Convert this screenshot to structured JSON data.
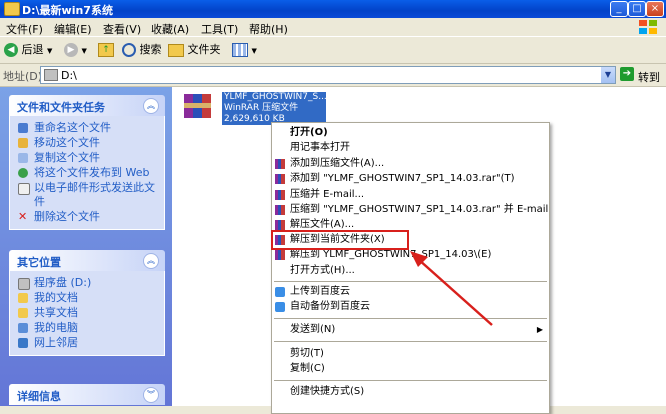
{
  "window": {
    "title": "D:\\最新win7系统"
  },
  "menubar": [
    "文件(F)",
    "编辑(E)",
    "查看(V)",
    "收藏(A)",
    "工具(T)",
    "帮助(H)"
  ],
  "toolbar": {
    "back": "后退",
    "search": "搜索",
    "folders": "文件夹"
  },
  "address": {
    "label": "地址(D)",
    "value": "D:\\",
    "go": "转到"
  },
  "tasks_panel": {
    "title": "文件和文件夹任务",
    "items": [
      "重命名这个文件",
      "移动这个文件",
      "复制这个文件",
      "将这个文件发布到 Web",
      "以电子邮件形式发送此文件",
      "删除这个文件"
    ]
  },
  "places_panel": {
    "title": "其它位置",
    "items": [
      "程序盘 (D:)",
      "我的文档",
      "共享文档",
      "我的电脑",
      "网上邻居"
    ]
  },
  "details_panel": {
    "title": "详细信息"
  },
  "file": {
    "name": "YLMF_GHOSTWIN7_S...",
    "type": "WinRAR 压缩文件",
    "size": "2,629,610 KB"
  },
  "context_menu": {
    "items": [
      "打开(O)",
      "用记事本打开",
      "添加到压缩文件(A)...",
      "添加到 \"YLMF_GHOSTWIN7_SP1_14.03.rar\"(T)",
      "压缩并 E-mail...",
      "压缩到 \"YLMF_GHOSTWIN7_SP1_14.03.rar\" 并 E-mail",
      "解压文件(A)...",
      "解压到当前文件夹(X)",
      "解压到 YLMF_GHOSTWIN7_SP1_14.03\\(E)",
      "打开方式(H)...",
      "上传到百度云",
      "自动备份到百度云",
      "发送到(N)",
      "剪切(T)",
      "复制(C)",
      "创建快捷方式(S)"
    ],
    "highlighted_item": "解压到当前文件夹(X)",
    "annotation_color": "#d8201c"
  },
  "colors": {
    "title_blue": "#0a5ee8",
    "task_link": "#215dc6",
    "selection": "#316ac5"
  }
}
